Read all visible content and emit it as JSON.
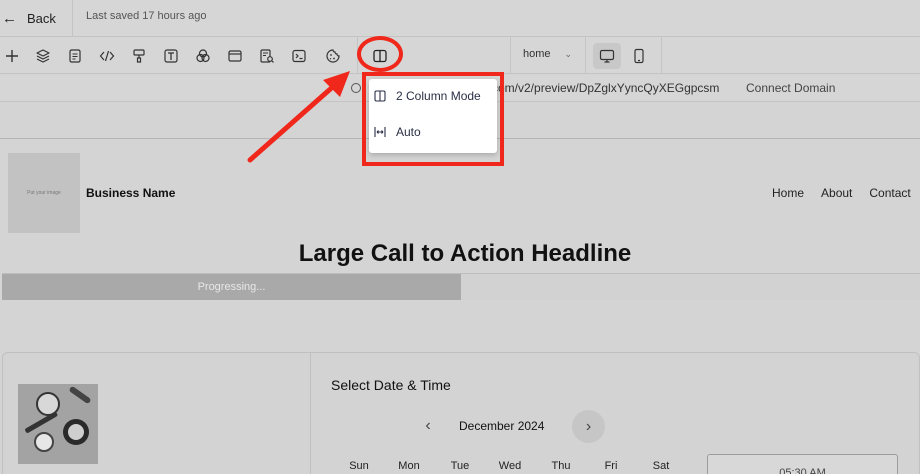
{
  "topbar": {
    "back_label": "Back",
    "saved_text": "Last saved 17 hours ago"
  },
  "toolbar": {
    "tools": [
      {
        "icon": "plus-icon",
        "name": "add-element-button"
      },
      {
        "icon": "layers-icon",
        "name": "layers-button"
      },
      {
        "icon": "pages-icon",
        "name": "pages-button"
      },
      {
        "icon": "code-icon",
        "name": "custom-code-button"
      },
      {
        "icon": "paint-roller-icon",
        "name": "styles-button"
      },
      {
        "icon": "text-icon",
        "name": "typography-button"
      },
      {
        "icon": "colors-icon",
        "name": "colors-button"
      },
      {
        "icon": "layout-icon",
        "name": "layout-button"
      },
      {
        "icon": "seo-icon",
        "name": "seo-button"
      },
      {
        "icon": "terminal-icon",
        "name": "tracking-code-button"
      },
      {
        "icon": "cookie-icon",
        "name": "cookies-button"
      },
      {
        "icon": "column-mode-icon",
        "name": "column-mode-button"
      }
    ],
    "page_select": "home",
    "devices": [
      "desktop-icon",
      "mobile-icon"
    ]
  },
  "urlbar": {
    "url": "e.com/v2/preview/DpZglxYyncQyXEGgpcsm",
    "connect_label": "Connect Domain"
  },
  "dropdown": {
    "items": [
      {
        "label": "2 Column Mode",
        "icon": "column-mode-icon"
      },
      {
        "label": "Auto",
        "icon": "auto-width-icon"
      }
    ]
  },
  "site": {
    "logo_text": "Put your image",
    "business_name": "Business Name",
    "nav": [
      "Home",
      "About",
      "Contact"
    ],
    "headline": "Large Call to Action Headline",
    "progress": {
      "label": "Progressing...",
      "fraction": 0.5
    },
    "booking": {
      "title": "Select Date & Time",
      "month": "December 2024",
      "weekdays": [
        "Sun",
        "Mon",
        "Tue",
        "Wed",
        "Thu",
        "Fri",
        "Sat"
      ],
      "first_slot": "05:30 AM"
    }
  },
  "annotation_color": "#f0271b"
}
